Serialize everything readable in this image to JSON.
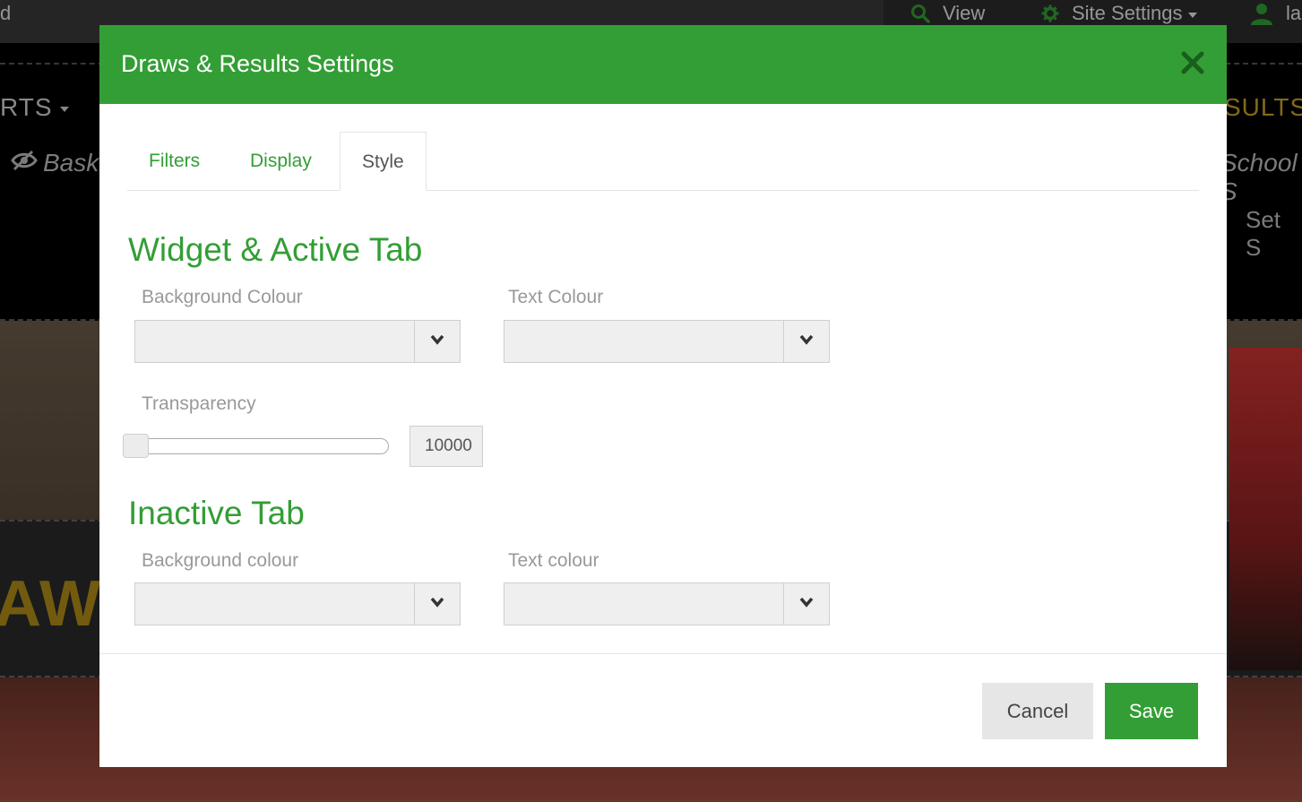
{
  "background": {
    "top_left_fragment": "d",
    "nav": {
      "view_label": "View",
      "site_settings_label": "Site Settings",
      "user_fragment": "la"
    },
    "menu_left_fragment": "RTS",
    "menu_right_fragment": "SULTS",
    "sub_left_fragment": "Bask",
    "sub_right_fragment": "School S",
    "set_fragment": "Set S",
    "hero_fragment": "AW"
  },
  "modal": {
    "title": "Draws & Results Settings",
    "tabs": [
      {
        "label": "Filters"
      },
      {
        "label": "Display"
      },
      {
        "label": "Style"
      }
    ],
    "active_tab": "Style",
    "widget_section": {
      "title": "Widget & Active Tab",
      "background_colour_label": "Background Colour",
      "text_colour_label": "Text Colour",
      "transparency_label": "Transparency",
      "transparency_value": "10000"
    },
    "inactive_section": {
      "title": "Inactive Tab",
      "background_colour_label": "Background colour",
      "text_colour_label": "Text colour"
    },
    "footer": {
      "cancel_label": "Cancel",
      "save_label": "Save"
    }
  },
  "colors": {
    "accent": "#339e35",
    "label_grey": "#999999",
    "input_bg": "#efefef"
  }
}
